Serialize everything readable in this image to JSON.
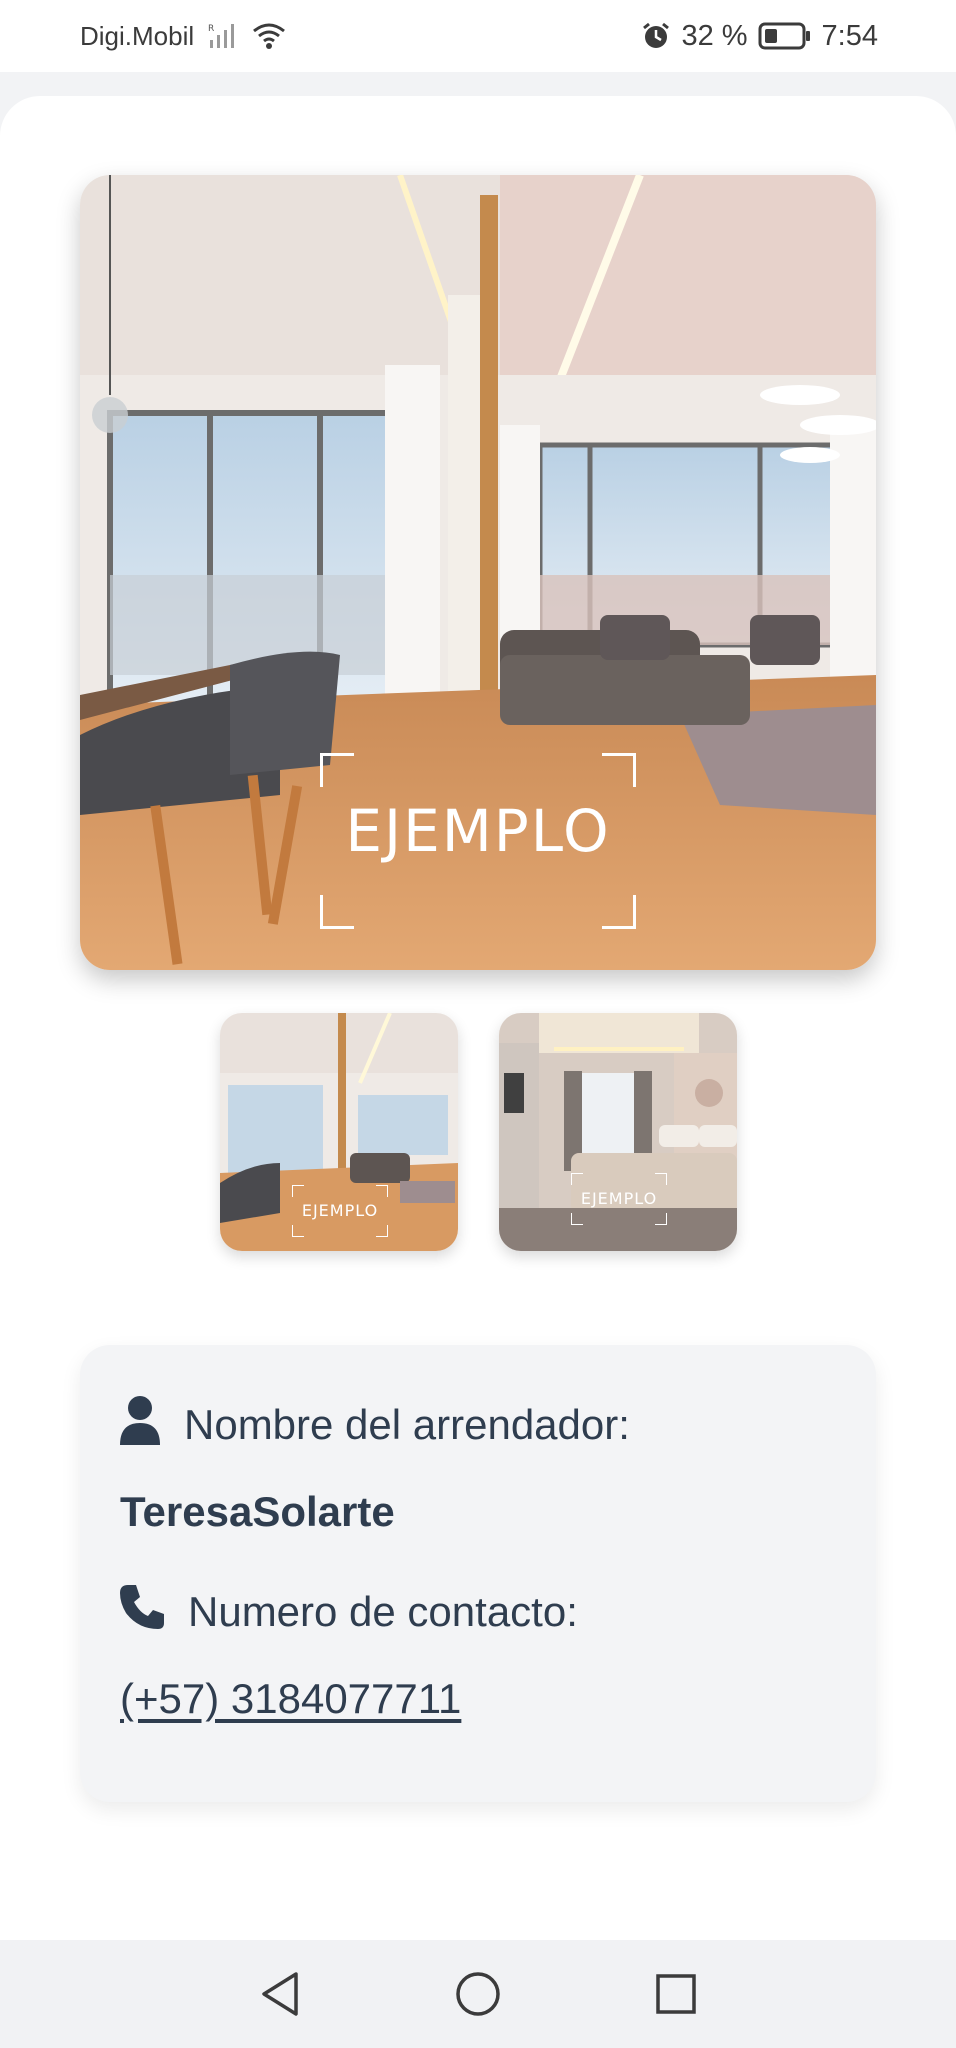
{
  "status_bar": {
    "carrier": "Digi.Mobil",
    "battery_percent": "32 %",
    "time": "7:54",
    "icons": [
      "signal-icon",
      "wifi-icon",
      "alarm-icon",
      "battery-icon"
    ]
  },
  "gallery": {
    "main_watermark": "EJEMPLO",
    "thumbnails": [
      {
        "watermark": "EJEMPLO",
        "scene": "living-room"
      },
      {
        "watermark": "EJEMPLO",
        "scene": "bedroom"
      }
    ]
  },
  "landlord": {
    "label": "Nombre del arrendador:",
    "name": "TeresaSolarte",
    "contact_label": "Numero de contacto:",
    "phone": "(+57) 3184077711"
  },
  "nav": {
    "icons": [
      "back-icon",
      "home-icon",
      "recents-icon"
    ]
  },
  "colors": {
    "text_primary": "#2f3d4f",
    "card_background": "#f3f4f6",
    "page_background": "#ffffff"
  }
}
